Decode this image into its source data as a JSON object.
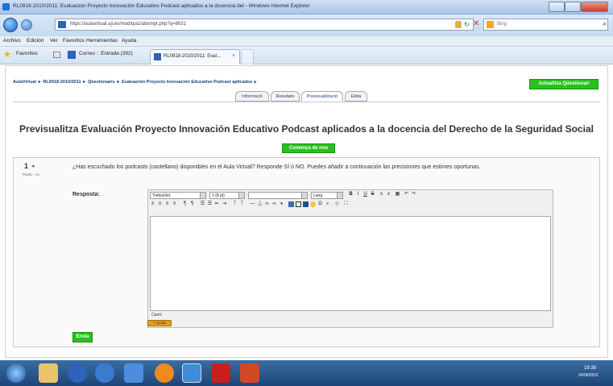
{
  "window": {
    "title": "RL0918-2010/2011: Evaluación Proyecto Innovación Educativo Podcast aplicados a la docencia del - Windows Internet Explorer"
  },
  "address_bar": {
    "url": "https://aulavirtual.uji.es/mod/quiz/attempt.php?q=8031",
    "search_placeholder": "Bing"
  },
  "menu": {
    "items": [
      "Archivo",
      "Edición",
      "Ver",
      "Favoritos",
      "Herramientas",
      "Ayuda"
    ]
  },
  "favorites_bar": {
    "favorites_label": "Favoritos",
    "mail_label": "Correo :: Entrada (392)",
    "tab_label": "RL0918-2010/2011: Eval..."
  },
  "page": {
    "breadcrumb": "AulaVirtual ► RL0918-2010/2011 ► Qüestionaris ► Evaluación Proyecto Innovación Educativo Podcast aplicados a",
    "update_button": "Actualitza Qüestionari",
    "tabs": [
      "Informació",
      "Resultats",
      "Previsualització",
      "Edita"
    ],
    "title": "Previsualitza Evaluación Proyecto Innovación Educativo Podcast aplicados a la docencia del Derecho de la Seguridad Social",
    "restart_button": "Comença de nou",
    "question": {
      "number": "1",
      "points": "Punts: --/1",
      "text": "¿Has escuchado los podcasts (castellano) disponibles en el Aula Virtual? Responde SÍ ó NO. Puedes añadir a continuación las precisiones que estimes oportunas.",
      "answer_label": "Resposta:"
    },
    "editor": {
      "font": "Trebuchet",
      "size": "1 (8 pt)",
      "lang": "Lang",
      "path_label": "Camí:",
      "status_badge": "? ayuda"
    },
    "send_button": "Envia"
  },
  "taskbar": {
    "time": "19:38",
    "date": "24/06/2011"
  },
  "colors": {
    "accent_green": "#26c21c",
    "link_blue": "#1c3e7d"
  }
}
